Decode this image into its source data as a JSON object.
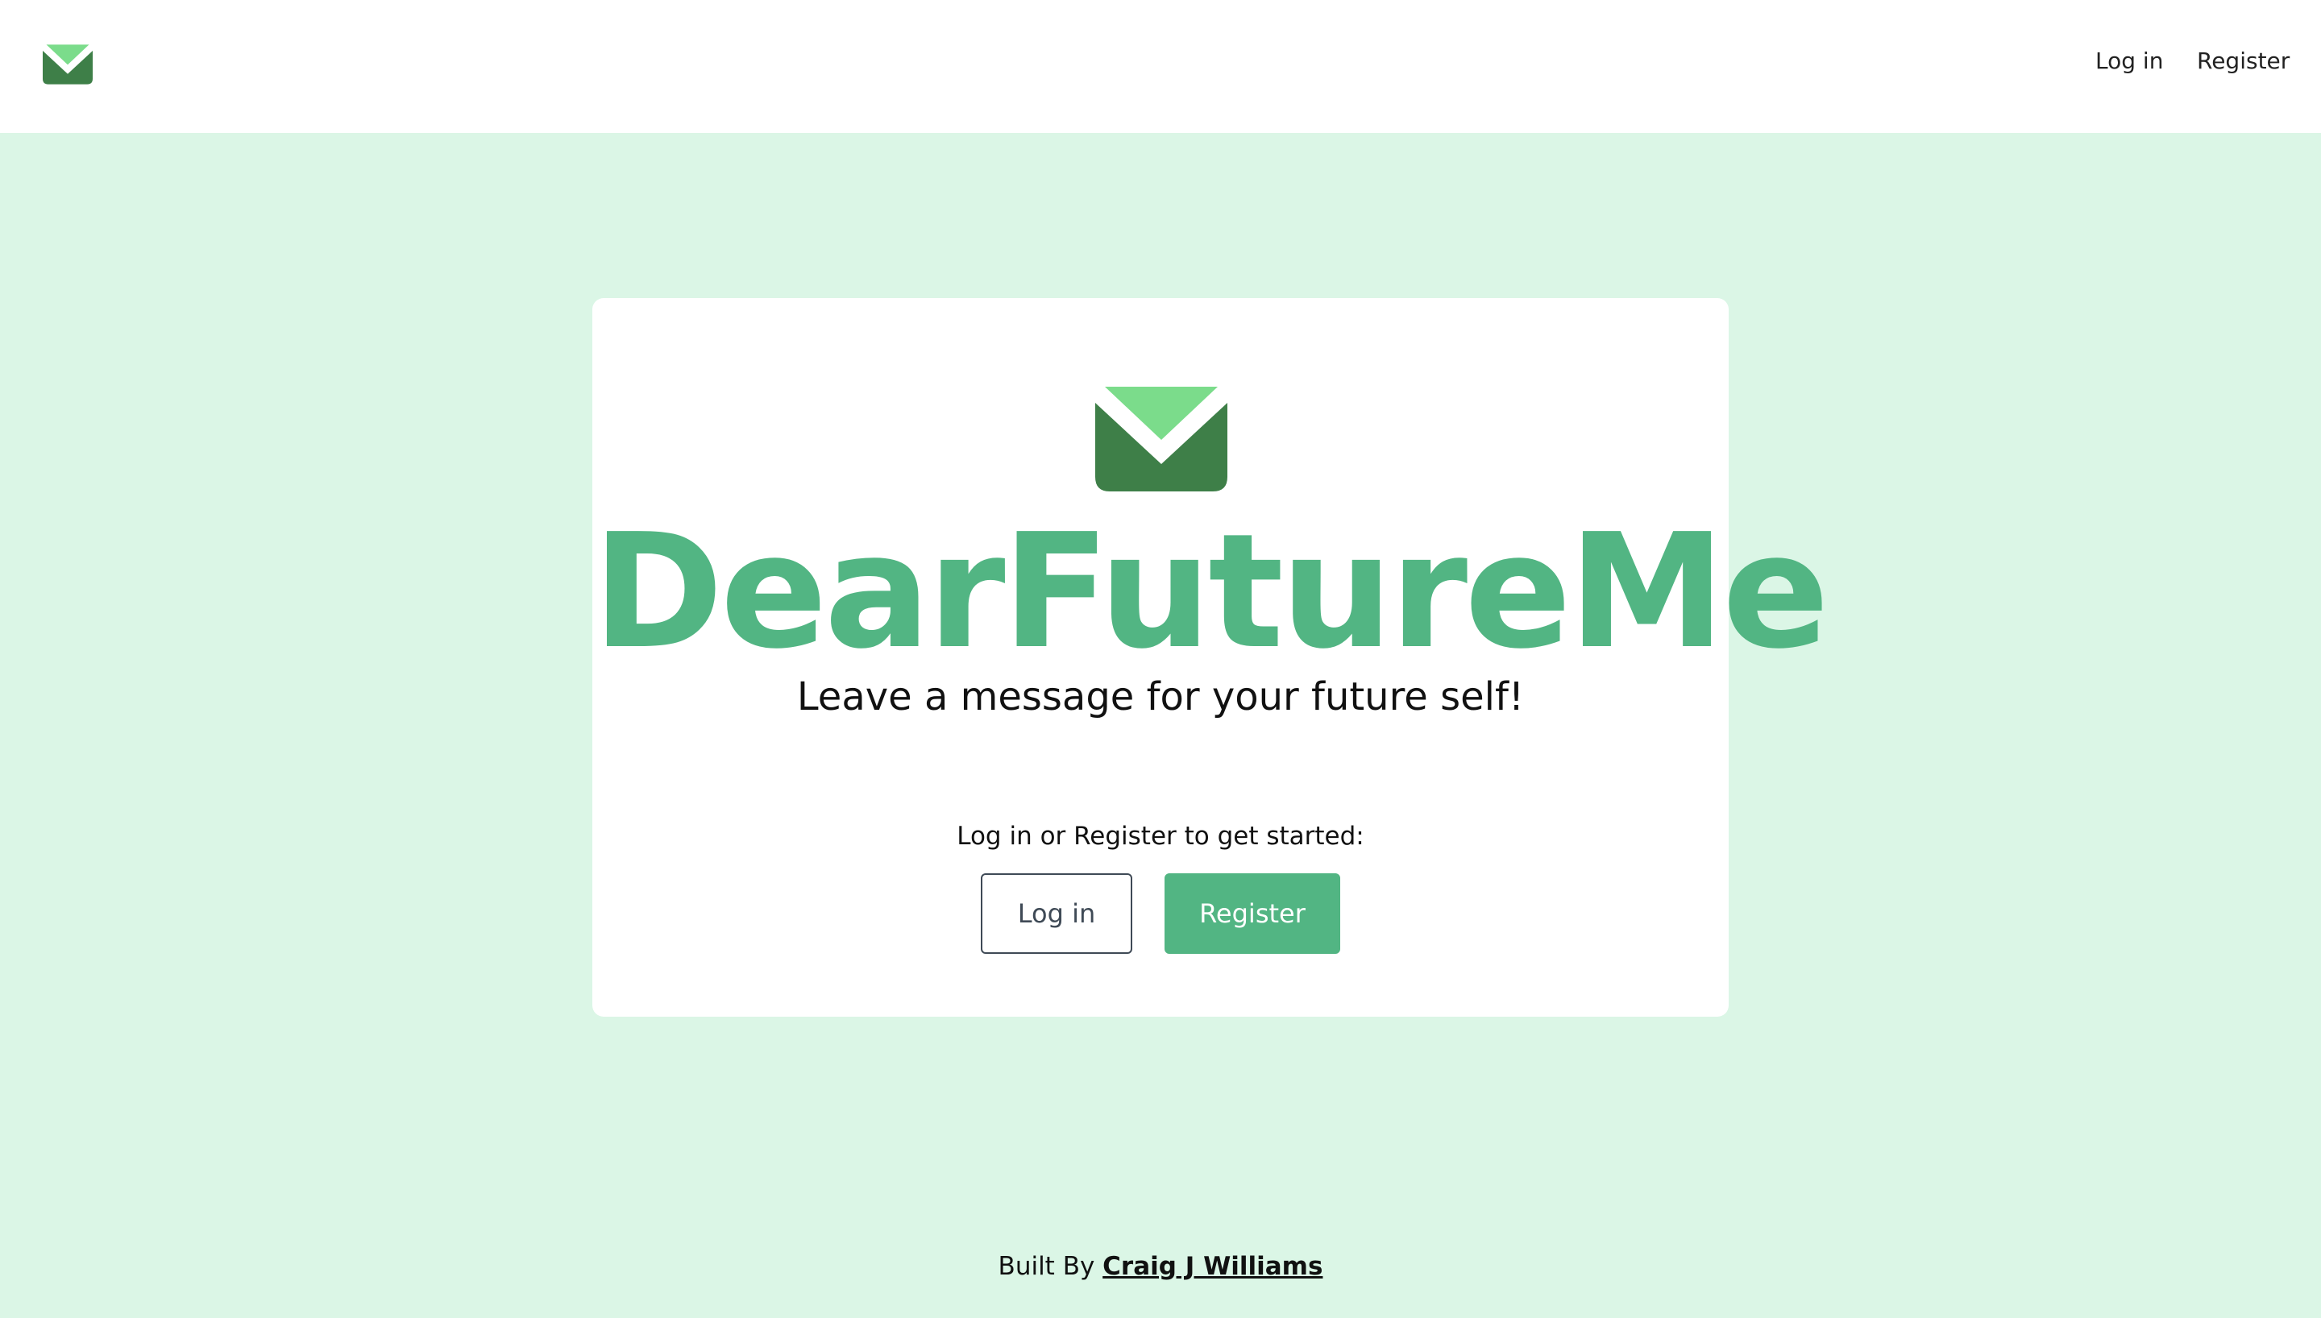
{
  "colors": {
    "page_background": "#dbf6e6",
    "header_background": "#ffffff",
    "card_background": "#ffffff",
    "brand_green": "#52b583",
    "envelope_dark": "#3e7f48",
    "envelope_light": "#7bdc8b",
    "outline_button_border": "#3f4a56"
  },
  "header": {
    "logo_icon": "envelope-icon",
    "nav": {
      "login_label": "Log in",
      "register_label": "Register"
    }
  },
  "hero": {
    "logo_icon": "envelope-icon",
    "title": "DearFutureMe",
    "subtitle": "Leave a message for your future self!",
    "cta_prompt": "Log in or Register to get started:",
    "login_button_label": "Log in",
    "register_button_label": "Register"
  },
  "footer": {
    "prefix": "Built By",
    "author_link_label": "Craig J Williams"
  }
}
